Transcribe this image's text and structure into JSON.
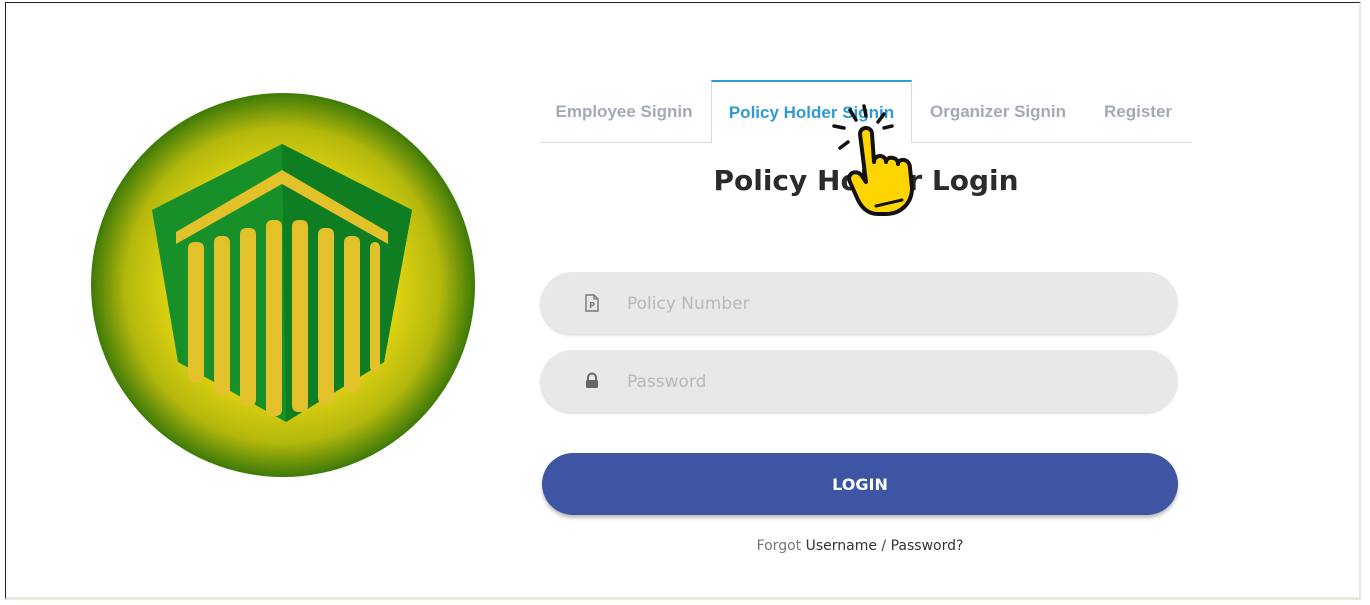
{
  "tabs": [
    {
      "label": "Employee Signin",
      "active": false
    },
    {
      "label": "Policy Holder Signin",
      "active": true
    },
    {
      "label": "Organizer Signin",
      "active": false
    },
    {
      "label": "Register",
      "active": false
    }
  ],
  "page_title": "Policy Holder Login",
  "form": {
    "policy_number": {
      "placeholder": "Policy Number",
      "icon": "policy-document-icon"
    },
    "password": {
      "placeholder": "Password",
      "icon": "lock-icon"
    },
    "login_label": "LOGIN"
  },
  "forgot": {
    "prefix": "Forgot",
    "username": "Username",
    "separator": "/",
    "password": "Password?"
  },
  "colors": {
    "active_tab": "#2f9ad6",
    "login_button": "#3e55a3",
    "logo_green": "#17902a",
    "logo_yellow": "#e3c12a"
  }
}
